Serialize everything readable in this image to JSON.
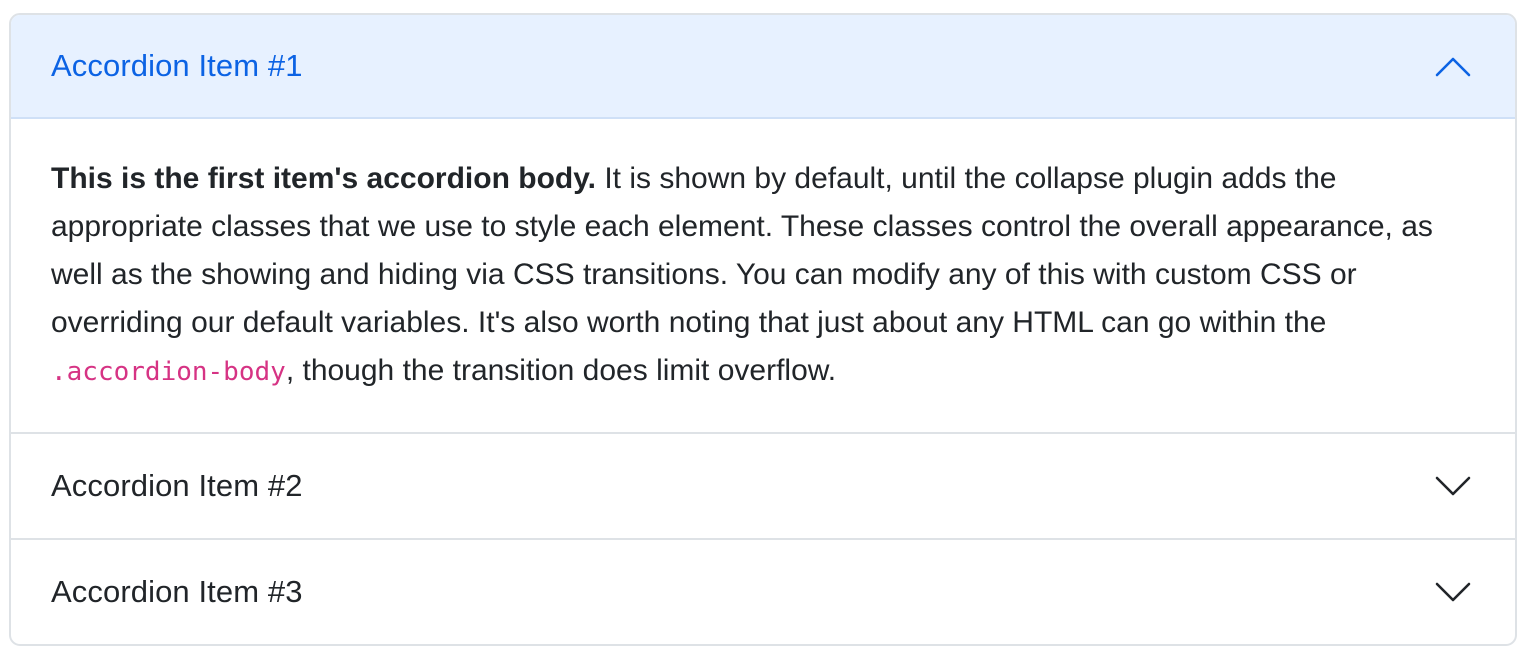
{
  "colors": {
    "accent": "#0c63e4",
    "active_header_bg": "#e7f1ff",
    "border": "#dee2e6",
    "text": "#212529",
    "code": "#d63384"
  },
  "accordion": {
    "items": [
      {
        "title": "Accordion Item #1",
        "expanded": true,
        "chevron": "chevron-up-icon",
        "body": {
          "strong": "This is the first item's accordion body.",
          "text_before_code": " It is shown by default, until the collapse plugin adds the appropriate classes that we use to style each element. These classes control the overall appearance, as well as the showing and hiding via CSS transitions. You can modify any of this with custom CSS or overriding our default variables. It's also worth noting that just about any HTML can go within the ",
          "code": ".accordion-body",
          "text_after_code": ", though the transition does limit overflow."
        }
      },
      {
        "title": "Accordion Item #2",
        "expanded": false,
        "chevron": "chevron-down-icon"
      },
      {
        "title": "Accordion Item #3",
        "expanded": false,
        "chevron": "chevron-down-icon"
      }
    ]
  }
}
